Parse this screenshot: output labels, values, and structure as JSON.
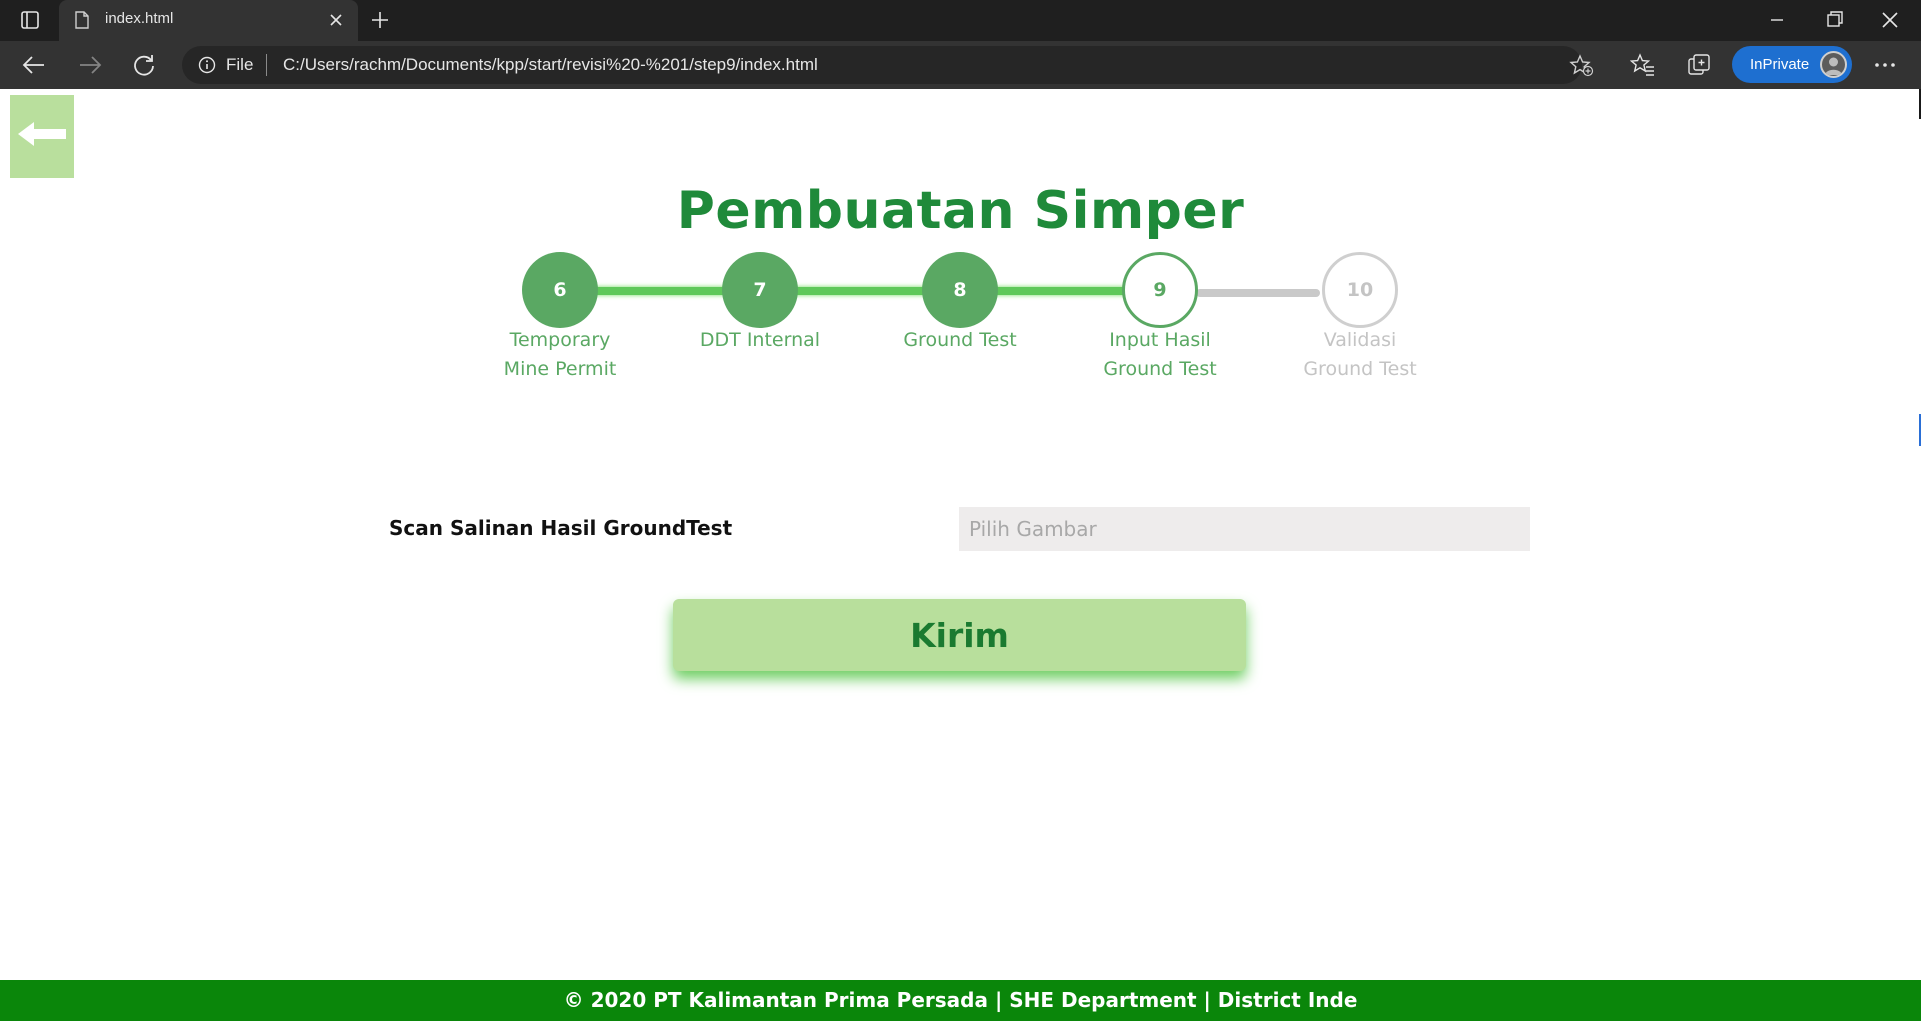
{
  "browser": {
    "tab_title": "index.html",
    "address_scheme": "File",
    "address_url": "C:/Users/rachm/Documents/kpp/start/revisi%20-%201/step9/index.html",
    "inprivate_label": "InPrivate"
  },
  "page": {
    "title": "Pembuatan Simper",
    "steps": [
      {
        "number": "6",
        "label_line1": "Temporary",
        "label_line2": "Mine Permit",
        "state": "done"
      },
      {
        "number": "7",
        "label_line1": "DDT Internal",
        "label_line2": "",
        "state": "done"
      },
      {
        "number": "8",
        "label_line1": "Ground Test",
        "label_line2": "",
        "state": "done"
      },
      {
        "number": "9",
        "label_line1": "Input Hasil",
        "label_line2": "Ground Test",
        "state": "current"
      },
      {
        "number": "10",
        "label_line1": "Validasi",
        "label_line2": "Ground Test",
        "state": "todo"
      }
    ],
    "form": {
      "field_label": "Scan Salinan Hasil GroundTest",
      "file_placeholder": "Pilih Gambar",
      "submit_label": "Kirim"
    },
    "footer_text": "© 2020 PT Kalimantan Prima Persada | SHE Department | District Inde"
  },
  "colors": {
    "brand_green": "#1f8a3a",
    "step_green": "#5aa863",
    "footer_green": "#0a860a",
    "button_green": "#b8df9c",
    "inactive_gray": "#c4c4c4"
  }
}
